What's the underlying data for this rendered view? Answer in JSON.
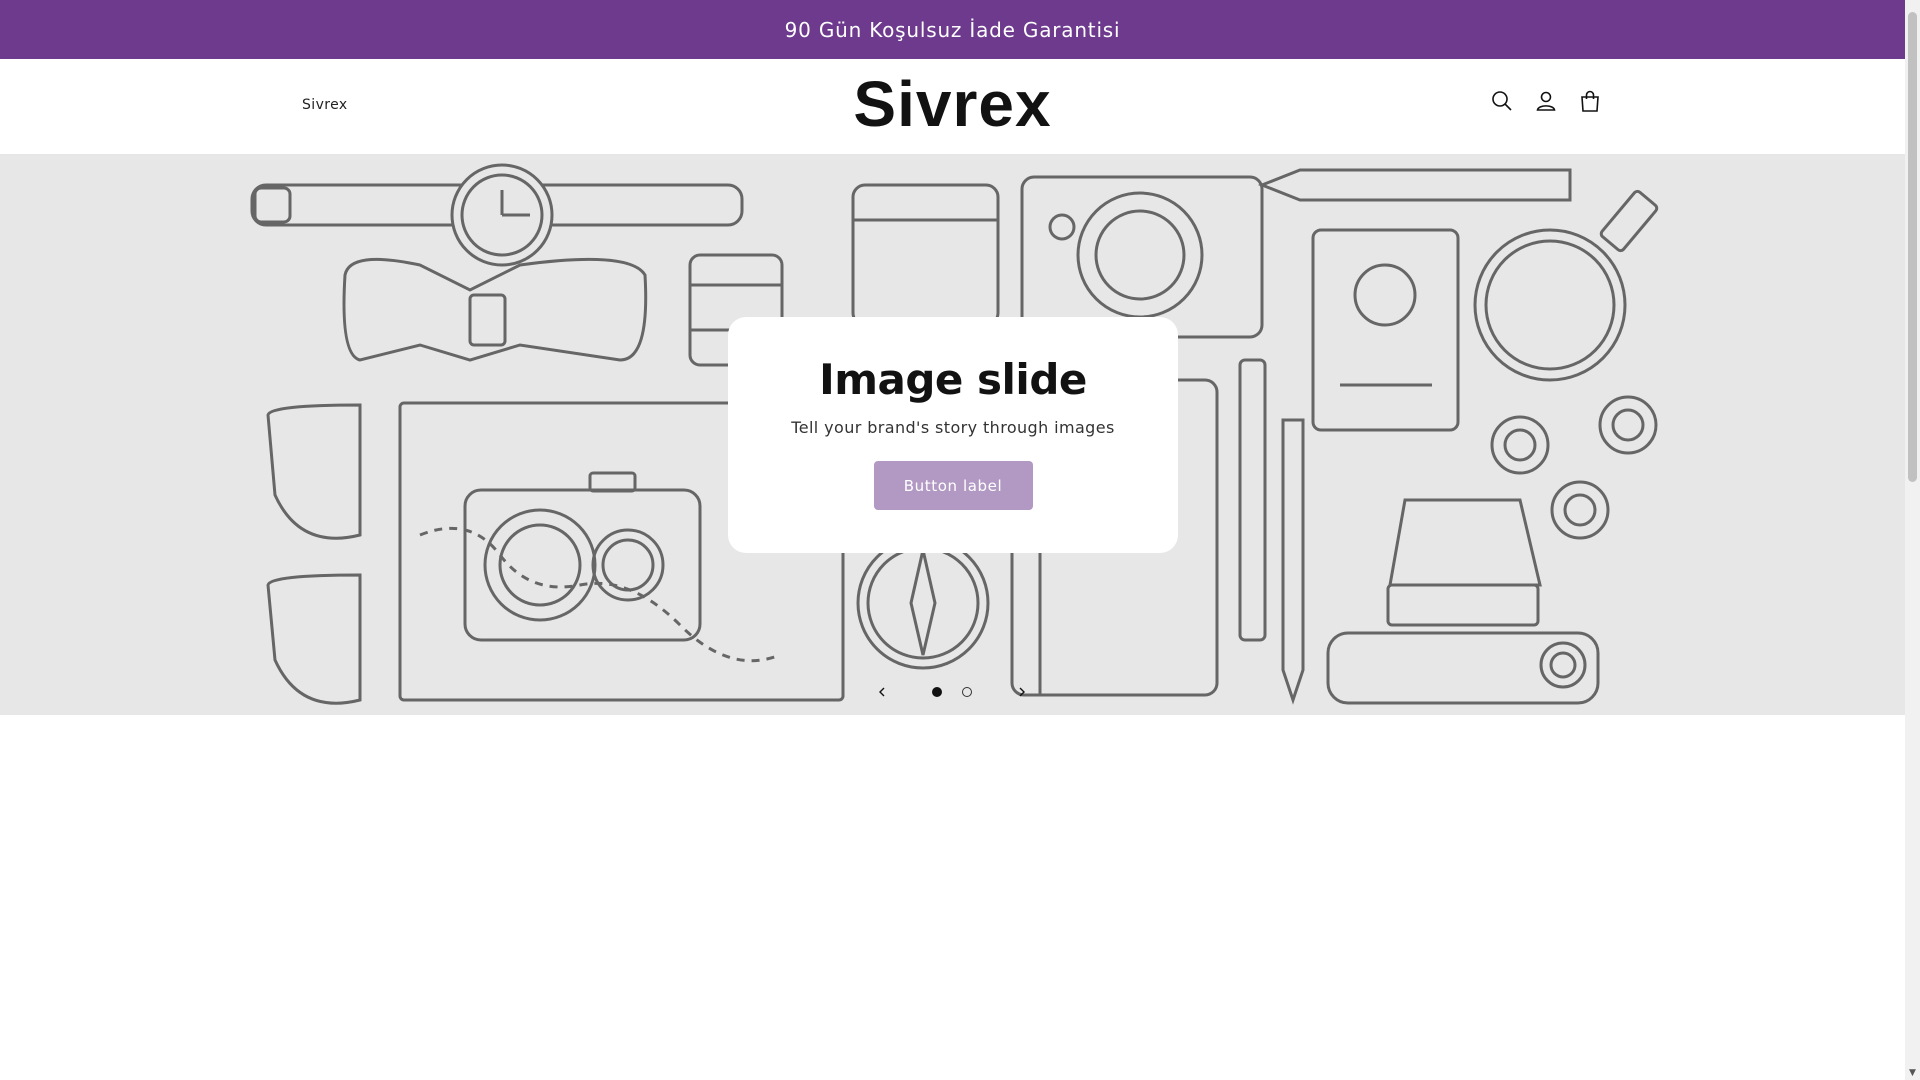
{
  "announcement": {
    "text": "90 Gün Koşulsuz İade Garantisi"
  },
  "header": {
    "nav_link": "Sivrex",
    "logo_text": "Sivrex",
    "icons": [
      "search-icon",
      "account-icon",
      "cart-icon"
    ]
  },
  "slideshow": {
    "title": "Image slide",
    "text": "Tell your brand's story through images",
    "button_label": "Button label",
    "slide_count": 2,
    "active_slide": 1
  },
  "colors": {
    "announcement_bg": "#6d3a8d",
    "button_bg": "#b299c4",
    "slideshow_bg": "#e7e7e7"
  }
}
